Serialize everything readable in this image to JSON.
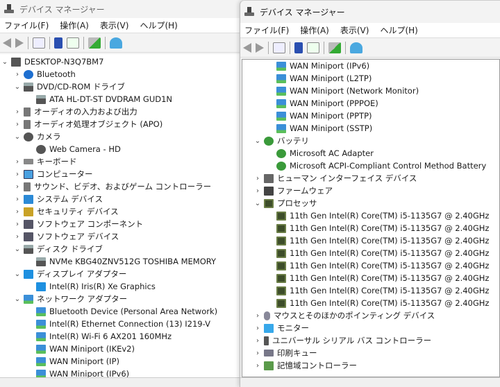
{
  "app_title": "デバイス マネージャー",
  "menu": [
    "ファイル(F)",
    "操作(A)",
    "表示(V)",
    "ヘルプ(H)"
  ],
  "left_tree": [
    {
      "t": "DESKTOP-N3Q7BM7",
      "l": 0,
      "c": "open",
      "i": "root"
    },
    {
      "t": "Bluetooth",
      "l": 1,
      "c": "closed",
      "i": "bt"
    },
    {
      "t": "DVD/CD-ROM ドライブ",
      "l": 1,
      "c": "open",
      "i": "disk"
    },
    {
      "t": "ATA HL-DT-ST DVDRAM GUD1N",
      "l": 2,
      "i": "disk"
    },
    {
      "t": "オーディオの入力および出力",
      "l": 1,
      "c": "closed",
      "i": "speaker"
    },
    {
      "t": "オーディオ処理オブジェクト (APO)",
      "l": 1,
      "c": "closed",
      "i": "speaker"
    },
    {
      "t": "カメラ",
      "l": 1,
      "c": "open",
      "i": "cam"
    },
    {
      "t": "Web Camera - HD",
      "l": 2,
      "i": "cam"
    },
    {
      "t": "キーボード",
      "l": 1,
      "c": "closed",
      "i": "kb"
    },
    {
      "t": "コンピューター",
      "l": 1,
      "c": "closed",
      "i": "pc"
    },
    {
      "t": "サウンド、ビデオ、およびゲーム コントローラー",
      "l": 1,
      "c": "closed",
      "i": "speaker"
    },
    {
      "t": "システム デバイス",
      "l": 1,
      "c": "closed",
      "i": "sys"
    },
    {
      "t": "セキュリティ デバイス",
      "l": 1,
      "c": "closed",
      "i": "sec"
    },
    {
      "t": "ソフトウェア コンポーネント",
      "l": 1,
      "c": "closed",
      "i": "sw"
    },
    {
      "t": "ソフトウェア デバイス",
      "l": 1,
      "c": "closed",
      "i": "sw"
    },
    {
      "t": "ディスク ドライブ",
      "l": 1,
      "c": "open",
      "i": "disk"
    },
    {
      "t": "NVMe KBG40ZNV512G TOSHIBA MEMORY",
      "l": 2,
      "i": "disk"
    },
    {
      "t": "ディスプレイ アダプター",
      "l": 1,
      "c": "open",
      "i": "disp"
    },
    {
      "t": "Intel(R) Iris(R) Xe Graphics",
      "l": 2,
      "i": "disp"
    },
    {
      "t": "ネットワーク アダプター",
      "l": 1,
      "c": "open",
      "i": "net"
    },
    {
      "t": "Bluetooth Device (Personal Area Network)",
      "l": 2,
      "i": "net"
    },
    {
      "t": "Intel(R) Ethernet Connection (13) I219-V",
      "l": 2,
      "i": "net"
    },
    {
      "t": "Intel(R) Wi-Fi 6 AX201 160MHz",
      "l": 2,
      "i": "net"
    },
    {
      "t": "WAN Miniport (IKEv2)",
      "l": 2,
      "i": "net"
    },
    {
      "t": "WAN Miniport (IP)",
      "l": 2,
      "i": "net"
    },
    {
      "t": "WAN Miniport (IPv6)",
      "l": 2,
      "i": "net"
    }
  ],
  "right_tree": [
    {
      "t": "WAN Miniport (IPv6)",
      "l": 2,
      "i": "net"
    },
    {
      "t": "WAN Miniport (L2TP)",
      "l": 2,
      "i": "net"
    },
    {
      "t": "WAN Miniport (Network Monitor)",
      "l": 2,
      "i": "net"
    },
    {
      "t": "WAN Miniport (PPPOE)",
      "l": 2,
      "i": "net"
    },
    {
      "t": "WAN Miniport (PPTP)",
      "l": 2,
      "i": "net"
    },
    {
      "t": "WAN Miniport (SSTP)",
      "l": 2,
      "i": "net"
    },
    {
      "t": "バッテリ",
      "l": 1,
      "c": "open",
      "i": "bat"
    },
    {
      "t": "Microsoft AC Adapter",
      "l": 2,
      "i": "bat"
    },
    {
      "t": "Microsoft ACPI-Compliant Control Method Battery",
      "l": 2,
      "i": "bat"
    },
    {
      "t": "ヒューマン インターフェイス デバイス",
      "l": 1,
      "c": "closed",
      "i": "hid"
    },
    {
      "t": "ファームウェア",
      "l": 1,
      "c": "closed",
      "i": "fw"
    },
    {
      "t": "プロセッサ",
      "l": 1,
      "c": "open",
      "i": "cpu"
    },
    {
      "t": "11th Gen Intel(R) Core(TM) i5-1135G7 @ 2.40GHz",
      "l": 2,
      "i": "cpu"
    },
    {
      "t": "11th Gen Intel(R) Core(TM) i5-1135G7 @ 2.40GHz",
      "l": 2,
      "i": "cpu"
    },
    {
      "t": "11th Gen Intel(R) Core(TM) i5-1135G7 @ 2.40GHz",
      "l": 2,
      "i": "cpu"
    },
    {
      "t": "11th Gen Intel(R) Core(TM) i5-1135G7 @ 2.40GHz",
      "l": 2,
      "i": "cpu"
    },
    {
      "t": "11th Gen Intel(R) Core(TM) i5-1135G7 @ 2.40GHz",
      "l": 2,
      "i": "cpu"
    },
    {
      "t": "11th Gen Intel(R) Core(TM) i5-1135G7 @ 2.40GHz",
      "l": 2,
      "i": "cpu"
    },
    {
      "t": "11th Gen Intel(R) Core(TM) i5-1135G7 @ 2.40GHz",
      "l": 2,
      "i": "cpu"
    },
    {
      "t": "11th Gen Intel(R) Core(TM) i5-1135G7 @ 2.40GHz",
      "l": 2,
      "i": "cpu"
    },
    {
      "t": "マウスとそのほかのポインティング デバイス",
      "l": 1,
      "c": "closed",
      "i": "mouse"
    },
    {
      "t": "モニター",
      "l": 1,
      "c": "closed",
      "i": "mon"
    },
    {
      "t": "ユニバーサル シリアル バス コントローラー",
      "l": 1,
      "c": "closed",
      "i": "usb"
    },
    {
      "t": "印刷キュー",
      "l": 1,
      "c": "closed",
      "i": "print"
    },
    {
      "t": "記憶域コントローラー",
      "l": 1,
      "c": "closed",
      "i": "stor"
    }
  ]
}
